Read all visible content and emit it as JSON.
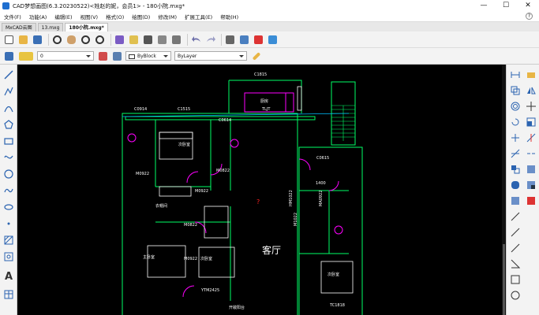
{
  "window": {
    "title": "CAD梦想画图(6.3.20230522)<姓赵的妮，会员1> - 180小院.mxg*",
    "minimize": "—",
    "maximize": "☐",
    "close": "✕"
  },
  "menu": [
    "文件(F)",
    "功能(A)",
    "编辑(E)",
    "视图(V)",
    "格式(O)",
    "绘图(D)",
    "修改(M)",
    "扩展工具(E)",
    "帮助(H)"
  ],
  "tabs": [
    {
      "label": "MxCAD云图"
    },
    {
      "label": "13.mxg"
    },
    {
      "label": "180小院.mxg*"
    }
  ],
  "properties": {
    "layer_value": "0",
    "color_value": "ByBlock",
    "linetype_value": "ByLayer"
  },
  "colors": {
    "canvas": "#000000",
    "walls": "#00ff66",
    "doors": "#ff00ff",
    "fixtures": "#ffffff",
    "axis": "#00bfff",
    "marker": "#ff2020",
    "accent_icon": "#1f6fd0"
  },
  "drawing": {
    "room_labels": [
      "客厅",
      "主卧室",
      "次卧室",
      "次卧室",
      "次卧室",
      "厨房",
      "衣帽间"
    ],
    "window_labels": [
      "C1815",
      "C0914",
      "C1515",
      "C0614",
      "C0615",
      "TC1818"
    ],
    "door_labels": [
      "M0922",
      "M0822",
      "M0922",
      "M0822",
      "M0922",
      "HM1022",
      "MA0922",
      "M1022"
    ],
    "other_labels": [
      "YTM2425",
      "开敞阳台",
      "1400",
      "TLJT",
      "?"
    ]
  },
  "icons": {
    "toolbar": [
      "new-file-icon",
      "open-icon",
      "save-icon",
      "zoom-icon",
      "pan-icon",
      "zoom-window-icon",
      "zoom-extents-icon",
      "properties-icon",
      "layer-icon",
      "block-icon",
      "undo-icon",
      "redo-icon",
      "print-icon",
      "print-preview-icon",
      "pdf-icon",
      "export-image-icon"
    ],
    "left": [
      "line-icon",
      "polyline-icon",
      "arc-icon",
      "rectangle-icon",
      "polygon-icon",
      "circle-icon",
      "spline-icon",
      "ellipse-icon",
      "point-icon",
      "hatch-icon",
      "insert-block-icon",
      "text-icon",
      "table-icon"
    ],
    "right": [
      "erase-icon",
      "copy-icon",
      "mirror-icon",
      "offset-icon",
      "array-icon",
      "move-icon",
      "rotate-icon",
      "scale-icon",
      "stretch-icon",
      "trim-icon",
      "extend-icon",
      "break-icon",
      "join-icon",
      "chamfer-icon",
      "fillet-icon",
      "explode-icon",
      "dimension-icon"
    ]
  }
}
